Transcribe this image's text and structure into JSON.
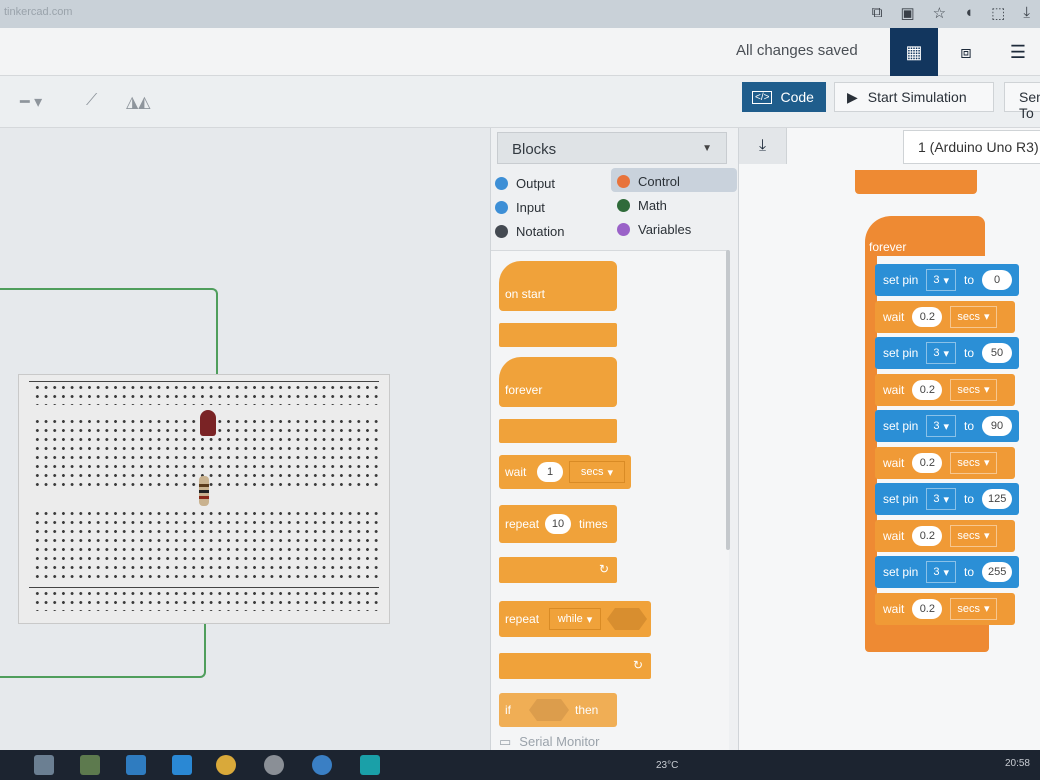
{
  "browser": {
    "tab_text": "tinkercad.com",
    "icons": [
      "screenshot-icon",
      "extensions-icon",
      "bookmark-star-icon",
      "audio-icon",
      "puzzle-icon",
      "downloads-icon"
    ]
  },
  "header": {
    "save_status": "All changes saved",
    "views": [
      "circuit-view",
      "schematic-view",
      "component-list-view"
    ]
  },
  "toolbar": {
    "code_label": "Code",
    "simulation_label": "Start Simulation",
    "send_label": "Send To"
  },
  "blocks_panel": {
    "category_select": "Blocks",
    "categories": [
      {
        "label": "Output",
        "color": "#3d8fd6"
      },
      {
        "label": "Input",
        "color": "#3d8fd6"
      },
      {
        "label": "Notation",
        "color": "#444a52"
      },
      {
        "label": "Control",
        "color": "#e8733b"
      },
      {
        "label": "Math",
        "color": "#2f6b3a"
      },
      {
        "label": "Variables",
        "color": "#9a62c8"
      }
    ],
    "selected_category": "Control",
    "palette": {
      "on_start": "on start",
      "forever": "forever",
      "wait": "wait",
      "wait_value": "1",
      "wait_unit": "secs",
      "repeat": "repeat",
      "repeat_value": "10",
      "repeat_unit": "times",
      "repeat_while": "repeat",
      "while_mode": "while",
      "if": "if",
      "then": "then"
    },
    "serial_monitor": "Serial Monitor"
  },
  "workspace": {
    "device": "1 (Arduino Uno R3)",
    "forever_label": "forever",
    "program": [
      {
        "type": "set_pin",
        "label": "set pin",
        "pin": "3",
        "to": "to",
        "value": "0"
      },
      {
        "type": "wait",
        "label": "wait",
        "value": "0.2",
        "unit": "secs"
      },
      {
        "type": "set_pin",
        "label": "set pin",
        "pin": "3",
        "to": "to",
        "value": "50"
      },
      {
        "type": "wait",
        "label": "wait",
        "value": "0.2",
        "unit": "secs"
      },
      {
        "type": "set_pin",
        "label": "set pin",
        "pin": "3",
        "to": "to",
        "value": "90"
      },
      {
        "type": "wait",
        "label": "wait",
        "value": "0.2",
        "unit": "secs"
      },
      {
        "type": "set_pin",
        "label": "set pin",
        "pin": "3",
        "to": "to",
        "value": "125"
      },
      {
        "type": "wait",
        "label": "wait",
        "value": "0.2",
        "unit": "secs"
      },
      {
        "type": "set_pin",
        "label": "set pin",
        "pin": "3",
        "to": "to",
        "value": "255"
      },
      {
        "type": "wait",
        "label": "wait",
        "value": "0.2",
        "unit": "secs"
      }
    ]
  },
  "taskbar": {
    "weather": "23°C",
    "clock": "20:58"
  }
}
